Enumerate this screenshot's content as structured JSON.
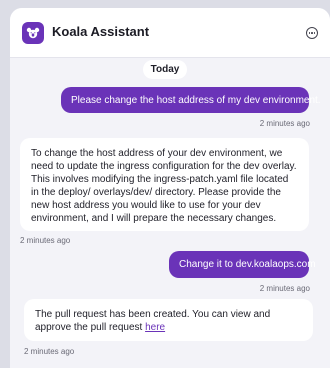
{
  "app": {
    "title": "Koala Assistant",
    "logo_icon": "koala-icon",
    "menu_icon": "more-options-icon"
  },
  "colors": {
    "accent": "#6a33b8",
    "window_bg": "#f3f3f8",
    "outer_bg": "#dcdde6"
  },
  "day_separator": "Today",
  "messages": [
    {
      "role": "user",
      "text": "Please change the host address of my dev environment.",
      "time": "2 minutes ago"
    },
    {
      "role": "assistant",
      "text": "To change the host address of your dev environment, we need to update the ingress configuration for the dev overlay. This involves modifying the ingress-patch.yaml file located in the deploy/ overlays/dev/ directory. Please provide the new host address you would like to use for your dev environment, and I will prepare the necessary changes.",
      "time": "2 minutes ago"
    },
    {
      "role": "user",
      "text": "Change it to dev.koalaops.com",
      "time": "2 minutes ago"
    },
    {
      "role": "assistant",
      "text": "The pull request has been created. You can view and approve the pull request ",
      "link_text": "here",
      "time": "2 minutes ago"
    }
  ]
}
